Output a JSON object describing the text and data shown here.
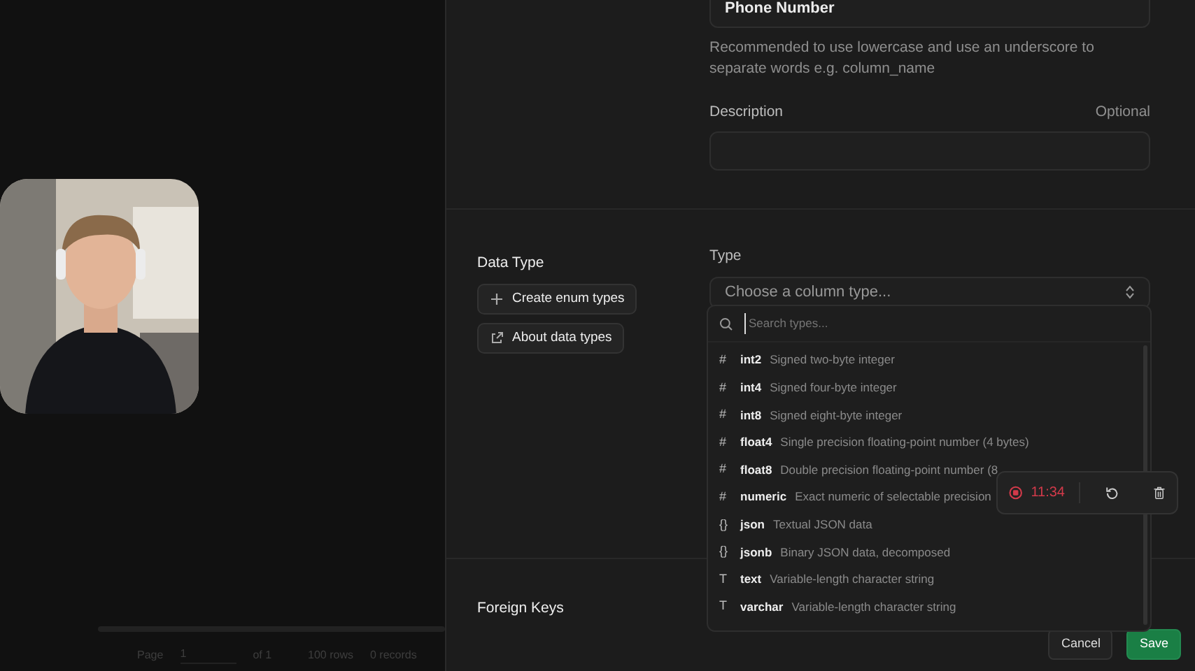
{
  "column_name": {
    "value": "Phone Number",
    "hint": "Recommended to use lowercase and use an underscore to separate words e.g. column_name"
  },
  "description": {
    "label": "Description",
    "optional": "Optional"
  },
  "data_type": {
    "title": "Data Type",
    "buttons": [
      {
        "label": "Create enum types",
        "kind": "plus"
      },
      {
        "label": "About data types",
        "kind": "external"
      }
    ]
  },
  "type_field": {
    "label": "Type",
    "placeholder": "Choose a column type..."
  },
  "type_menu": {
    "search_placeholder": "Search types...",
    "items": [
      {
        "symbol": "#",
        "name": "int2",
        "description": "Signed two-byte integer"
      },
      {
        "symbol": "#",
        "name": "int4",
        "description": "Signed four-byte integer"
      },
      {
        "symbol": "#",
        "name": "int8",
        "description": "Signed eight-byte integer"
      },
      {
        "symbol": "#",
        "name": "float4",
        "description": "Single precision floating-point number (4 bytes)"
      },
      {
        "symbol": "#",
        "name": "float8",
        "description": "Double precision floating-point number (8"
      },
      {
        "symbol": "#",
        "name": "numeric",
        "description": "Exact numeric of selectable precision"
      },
      {
        "symbol": "{}",
        "name": "json",
        "description": "Textual JSON data"
      },
      {
        "symbol": "{}",
        "name": "jsonb",
        "description": "Binary JSON data, decomposed"
      },
      {
        "symbol": "T",
        "name": "text",
        "description": "Variable-length character string"
      },
      {
        "symbol": "T",
        "name": "varchar",
        "description": "Variable-length character string"
      }
    ]
  },
  "foreign_keys": {
    "title": "Foreign Keys"
  },
  "footer": {
    "buttons": [
      {
        "label": "Cancel",
        "kind": "secondary"
      },
      {
        "label": "Save",
        "kind": "primary"
      }
    ]
  },
  "recorder": {
    "time": "11:34"
  },
  "table_footer": {
    "page_label": "Page",
    "page": "1",
    "of": "of 1",
    "rows": "100 rows",
    "records": "0 records"
  }
}
